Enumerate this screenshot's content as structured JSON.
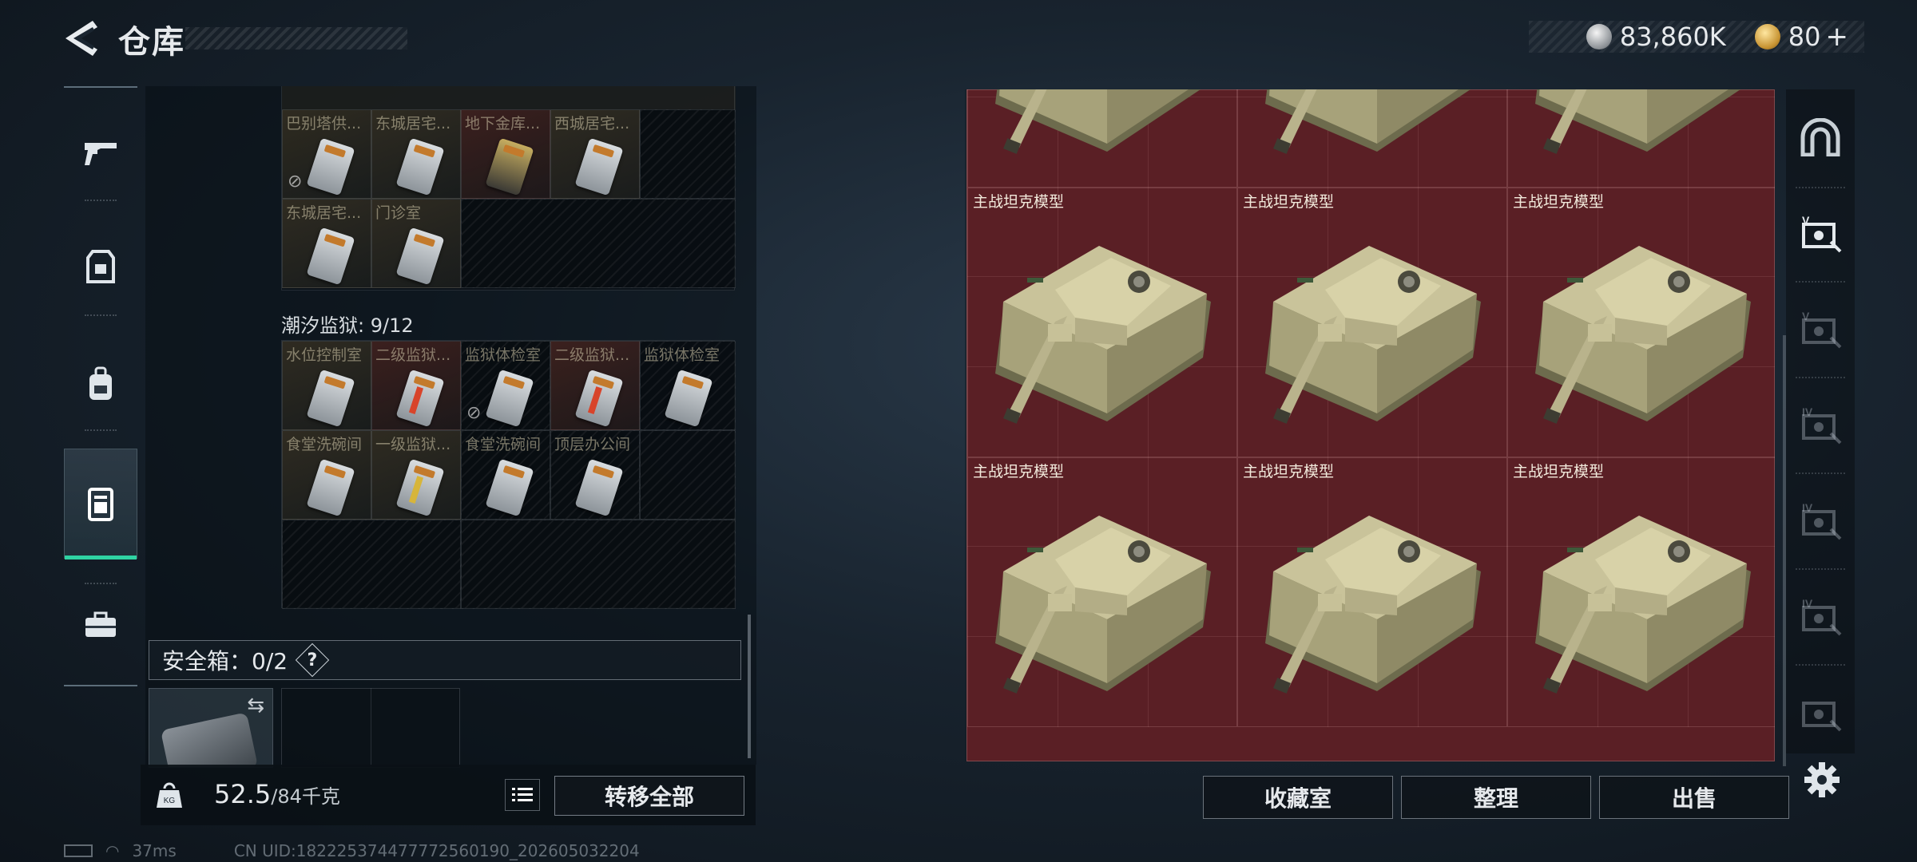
{
  "header": {
    "title": "仓库",
    "silver_amount": "83,860K",
    "gold_amount": "80",
    "gold_plus": "+"
  },
  "left_nav": {
    "items": [
      {
        "name": "weapons",
        "icon": "gun-icon"
      },
      {
        "name": "armor",
        "icon": "armor-icon"
      },
      {
        "name": "backpack",
        "icon": "backpack-icon"
      },
      {
        "name": "storage",
        "icon": "locker-icon",
        "active": true
      },
      {
        "name": "kit",
        "icon": "briefcase-icon"
      }
    ]
  },
  "storage": {
    "top_cells_row1": [
      {
        "label": "巴别塔供..."
      },
      {
        "label": "东城居宅..."
      },
      {
        "label": "地下金库..."
      },
      {
        "label": "西城居宅..."
      },
      {
        "label": ""
      }
    ],
    "top_cells_row2": [
      {
        "label": "东城居宅..."
      },
      {
        "label": "门诊室"
      }
    ],
    "section_label": "潮汐监狱: 9/12",
    "prison_row1": [
      {
        "label": "水位控制室"
      },
      {
        "label": "二级监狱..."
      },
      {
        "label": "监狱体检室"
      },
      {
        "label": "二级监狱..."
      },
      {
        "label": "监狱体检室"
      }
    ],
    "prison_row2": [
      {
        "label": "食堂洗碗间"
      },
      {
        "label": "一级监狱..."
      },
      {
        "label": "食堂洗碗间"
      },
      {
        "label": "顶层办公间"
      }
    ],
    "safe_box_label": "安全箱：0/2",
    "help_symbol": "?",
    "weight_value": "52.5",
    "weight_max": "/84千克",
    "transfer_all": "转移全部"
  },
  "status": {
    "ping": "37ms",
    "uid": "CN UID:182225374477772560190_202605032204"
  },
  "collection": {
    "item_label": "主战坦克模型",
    "buttons": {
      "collection_room": "收藏室",
      "organize": "整理",
      "sell": "出售"
    },
    "colors": {
      "tank_bg": "#5a1f25",
      "accent": "#2fd3a3"
    }
  },
  "right_nav": {
    "tiers": [
      "V",
      "V",
      "IV",
      "IV",
      "IV",
      ""
    ]
  }
}
